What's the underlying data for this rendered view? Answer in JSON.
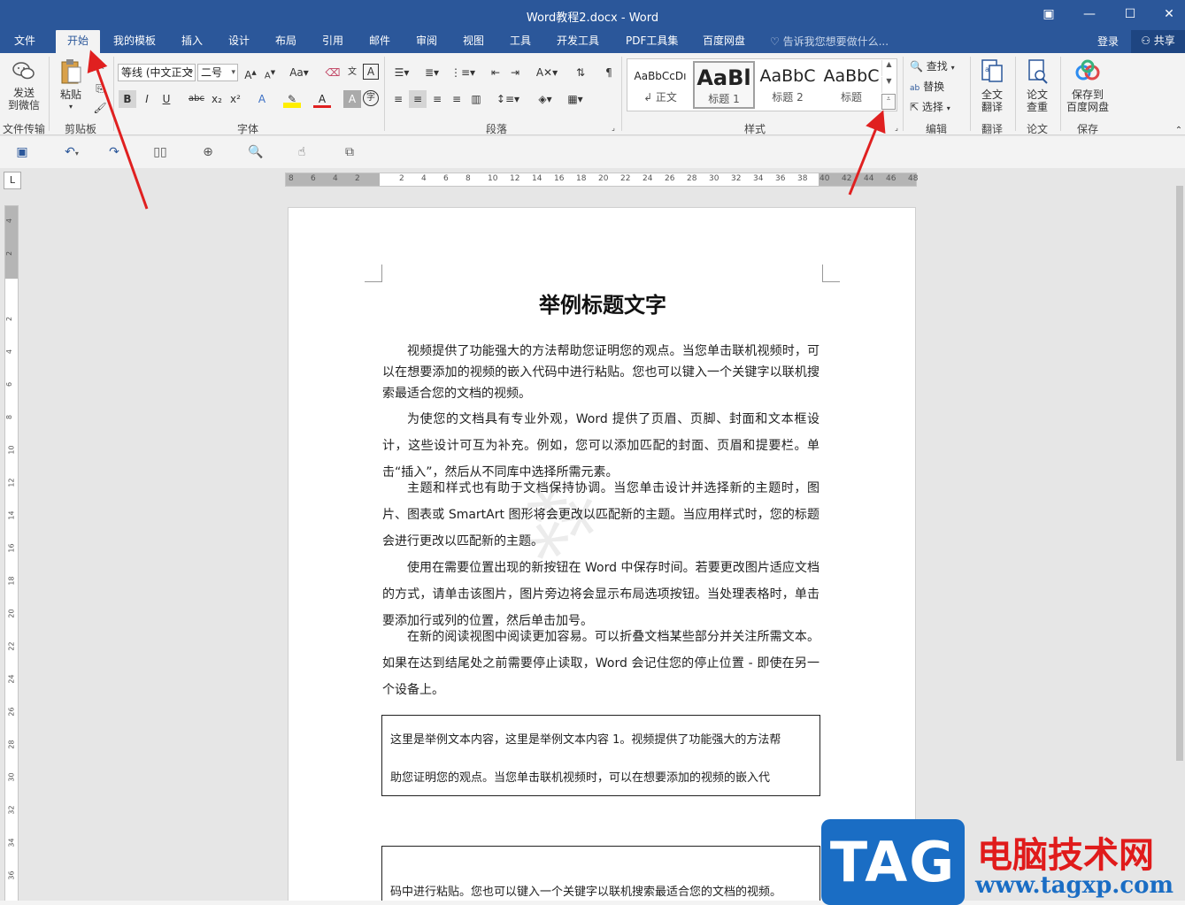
{
  "window": {
    "title": "Word教程2.docx - Word"
  },
  "tabs": [
    {
      "label": "文件"
    },
    {
      "label": "开始"
    },
    {
      "label": "我的模板"
    },
    {
      "label": "插入"
    },
    {
      "label": "设计"
    },
    {
      "label": "布局"
    },
    {
      "label": "引用"
    },
    {
      "label": "邮件"
    },
    {
      "label": "审阅"
    },
    {
      "label": "视图"
    },
    {
      "label": "工具"
    },
    {
      "label": "开发工具"
    },
    {
      "label": "PDF工具集"
    },
    {
      "label": "百度网盘"
    }
  ],
  "tellme_placeholder": "告诉我您想要做什么...",
  "login_label": "登录",
  "share_label": "共享",
  "ribbon": {
    "send_wechat": "发送\n到微信",
    "send_wechat_line1": "发送",
    "send_wechat_line2": "到微信",
    "paste": "粘贴",
    "font_name": "等线 (中文正文",
    "font_size": "二号",
    "find": "查找",
    "replace": "替换",
    "select": "选择",
    "full_translate_line1": "全文",
    "full_translate_line2": "翻译",
    "paper_check_line1": "论文",
    "paper_check_line2": "查重",
    "save_baidu_line1": "保存到",
    "save_baidu_line2": "百度网盘",
    "groups": {
      "file_transfer": "文件传输",
      "clipboard": "剪贴板",
      "font": "字体",
      "paragraph": "段落",
      "styles": "样式",
      "editing": "编辑",
      "translate": "翻译",
      "paper": "论文",
      "save": "保存"
    },
    "styles": [
      {
        "preview": "AaBbCcDı",
        "name": "↲ 正文"
      },
      {
        "preview": "AaBl",
        "name": "标题 1"
      },
      {
        "preview": "AaBbC",
        "name": "标题 2"
      },
      {
        "preview": "AaBbC",
        "name": "标题"
      }
    ],
    "font_buttons": {
      "bold": "B",
      "italic": "I",
      "underline": "U",
      "strike": "abc",
      "subscript": "x₂",
      "superscript": "x²"
    }
  },
  "ruler": {
    "h_labels": [
      "8",
      "6",
      "4",
      "2",
      "",
      "2",
      "4",
      "6",
      "8",
      "10",
      "12",
      "14",
      "16",
      "18",
      "20",
      "22",
      "24",
      "26",
      "28",
      "30",
      "32",
      "34",
      "36",
      "38",
      "40",
      "42",
      "44",
      "46",
      "48"
    ],
    "v_labels": [
      "4",
      "2",
      "",
      "2",
      "4",
      "6",
      "8",
      "10",
      "12",
      "14",
      "16",
      "18",
      "20",
      "22",
      "24",
      "26",
      "28",
      "30",
      "32",
      "34",
      "36"
    ],
    "corner": "L"
  },
  "document": {
    "title": "举例标题文字",
    "paragraphs": [
      "视频提供了功能强大的方法帮助您证明您的观点。当您单击联机视频时，可以在想要添加的视频的嵌入代码中进行粘贴。您也可以键入一个关键字以联机搜索最适合您的文档的视频。",
      "为使您的文档具有专业外观，Word 提供了页眉、页脚、封面和文本框设计，这些设计可互为补充。例如，您可以添加匹配的封面、页眉和提要栏。单击“插入”，然后从不同库中选择所需元素。",
      "主题和样式也有助于文档保持协调。当您单击设计并选择新的主题时，图片、图表或 SmartArt 图形将会更改以匹配新的主题。当应用样式时，您的标题会进行更改以匹配新的主题。",
      "使用在需要位置出现的新按钮在 Word 中保存时间。若要更改图片适应文档的方式，请单击该图片，图片旁边将会显示布局选项按钮。当处理表格时，单击要添加行或列的位置，然后单击加号。",
      "在新的阅读视图中阅读更加容易。可以折叠文档某些部分并关注所需文本。如果在达到结尾处之前需要停止读取，Word 会记住您的停止位置 - 即使在另一个设备上。"
    ],
    "textbox1_line1": "这里是举例文本内容，这里是举例文本内容 1。视频提供了功能强大的方法帮",
    "textbox1_line2": "助您证明您的观点。当您单击联机视频时，可以在想要添加的视频的嵌入代",
    "textbox2_line1": "码中进行粘贴。您也可以键入一个关键字以联机搜索最适合您的文档的视频。"
  },
  "logo": {
    "tag": "TAG",
    "cn": "电脑技术网",
    "url": "www.tagxp.com"
  },
  "colors": {
    "word_blue": "#2b579a",
    "arrow_red": "#e02020"
  }
}
